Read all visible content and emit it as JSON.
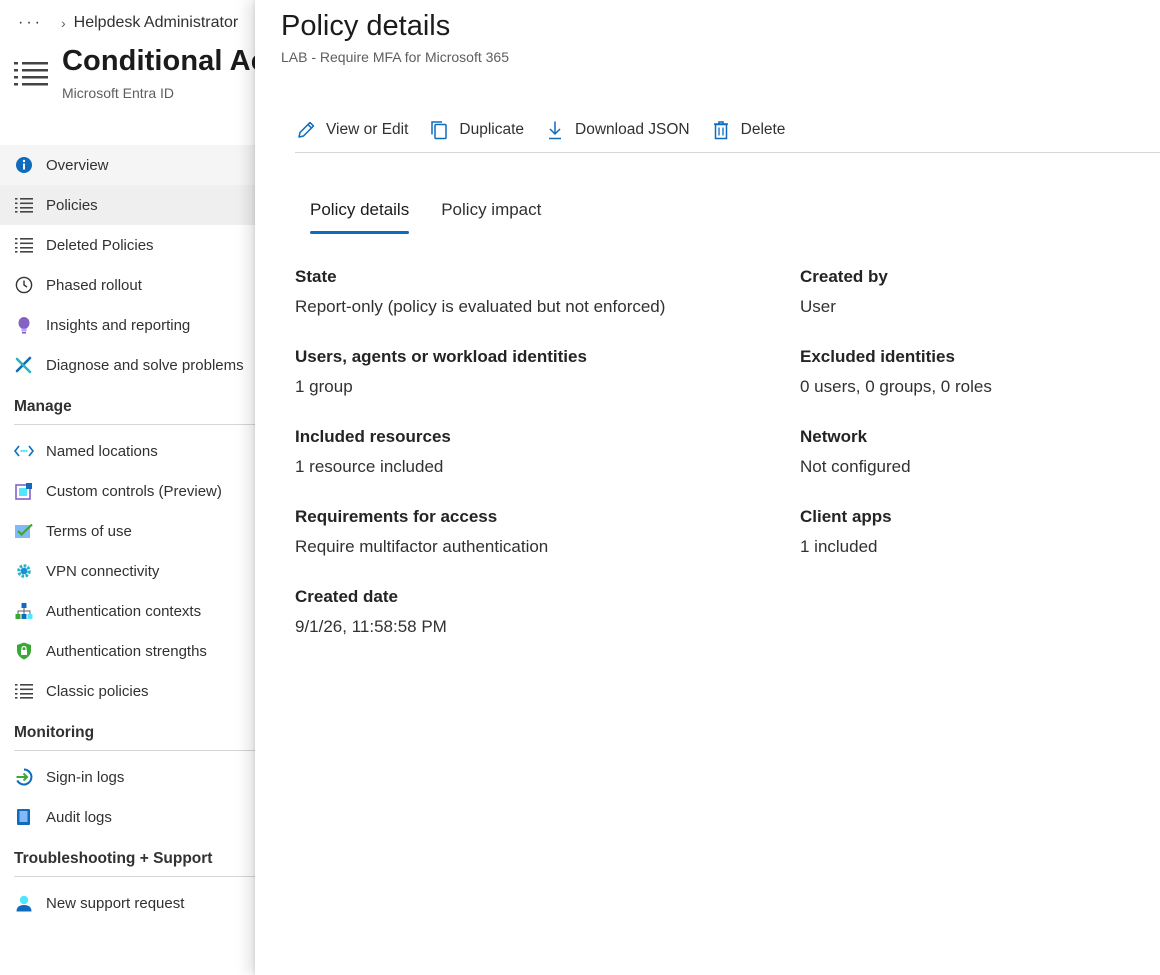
{
  "breadcrumb": {
    "more": "···",
    "separator": "›",
    "item": "Helpdesk Administrator"
  },
  "app": {
    "title": "Conditional Access",
    "subtitle": "Microsoft Entra ID"
  },
  "nav": {
    "top_items": [
      {
        "label": "Overview"
      },
      {
        "label": "Policies"
      },
      {
        "label": "Deleted Policies"
      },
      {
        "label": "Phased rollout"
      },
      {
        "label": "Insights and reporting"
      },
      {
        "label": "Diagnose and solve problems"
      }
    ],
    "manage_title": "Manage",
    "manage_items": [
      {
        "label": "Named locations"
      },
      {
        "label": "Custom controls (Preview)"
      },
      {
        "label": "Terms of use"
      },
      {
        "label": "VPN connectivity"
      },
      {
        "label": "Authentication contexts"
      },
      {
        "label": "Authentication strengths"
      },
      {
        "label": "Classic policies"
      }
    ],
    "monitoring_title": "Monitoring",
    "monitoring_items": [
      {
        "label": "Sign-in logs"
      },
      {
        "label": "Audit logs"
      }
    ],
    "support_title": "Troubleshooting + Support",
    "support_items": [
      {
        "label": "New support request"
      }
    ]
  },
  "panel": {
    "title": "Policy details",
    "subtitle": "LAB - Require MFA for Microsoft 365",
    "toolbar": {
      "view_edit": "View or Edit",
      "duplicate": "Duplicate",
      "download": "Download JSON",
      "delete": "Delete"
    },
    "tabs": [
      {
        "label": "Policy details"
      },
      {
        "label": "Policy impact"
      }
    ],
    "fields_left": [
      {
        "label": "State",
        "value": "Report-only (policy is evaluated but not enforced)"
      },
      {
        "label": "Users, agents or workload identities",
        "value": "1 group"
      },
      {
        "label": "Included resources",
        "value": "1 resource included"
      },
      {
        "label": "Requirements for access",
        "value": "Require multifactor authentication"
      },
      {
        "label": "Created date",
        "value": "9/1/26, 11:58:58 PM"
      }
    ],
    "fields_right": [
      {
        "label": "Created by",
        "value": "User"
      },
      {
        "label": "Excluded identities",
        "value": "0 users, 0 groups, 0 roles"
      },
      {
        "label": "Network",
        "value": "Not configured"
      },
      {
        "label": "Client apps",
        "value": "1 included"
      }
    ]
  },
  "colors": {
    "accent": "#0f6cbd",
    "nav_active_bg": "#efefef"
  }
}
